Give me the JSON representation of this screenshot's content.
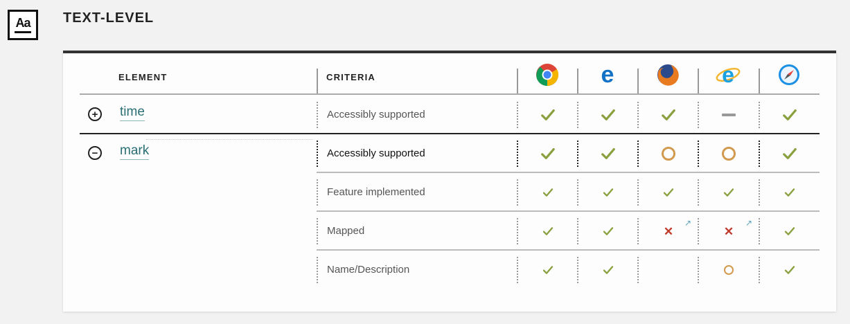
{
  "section": {
    "title": "TEXT-LEVEL",
    "logo": "Aa"
  },
  "table": {
    "headers": {
      "element": "ELEMENT",
      "criteria": "CRITERIA"
    },
    "browsers": [
      {
        "name": "Chrome",
        "icon": "chrome-icon"
      },
      {
        "name": "Edge",
        "icon": "edge-icon"
      },
      {
        "name": "Firefox",
        "icon": "firefox-icon"
      },
      {
        "name": "Internet Explorer",
        "icon": "ie-icon"
      },
      {
        "name": "Safari",
        "icon": "safari-icon"
      }
    ],
    "rows": [
      {
        "element": "time",
        "toggle": "+",
        "criteria": [
          {
            "label": "Accessibly supported",
            "values": [
              "yes",
              "yes",
              "yes",
              "none",
              "yes"
            ]
          }
        ]
      },
      {
        "element": "mark",
        "toggle": "−",
        "criteria": [
          {
            "label": "Accessibly supported",
            "values": [
              "yes",
              "yes",
              "partial",
              "partial",
              "yes"
            ]
          },
          {
            "label": "Feature implemented",
            "values": [
              "yes",
              "yes",
              "yes",
              "yes",
              "yes"
            ]
          },
          {
            "label": "Mapped",
            "values": [
              "yes",
              "yes",
              "no",
              "no",
              "yes"
            ]
          },
          {
            "label": "Name/Description",
            "values": [
              "yes",
              "yes",
              "",
              "partial",
              "yes"
            ]
          }
        ]
      }
    ]
  },
  "colors": {
    "check": "#8aa03f",
    "partial": "#d19a4e",
    "cross": "#c0392b",
    "link": "#2a6f74"
  }
}
